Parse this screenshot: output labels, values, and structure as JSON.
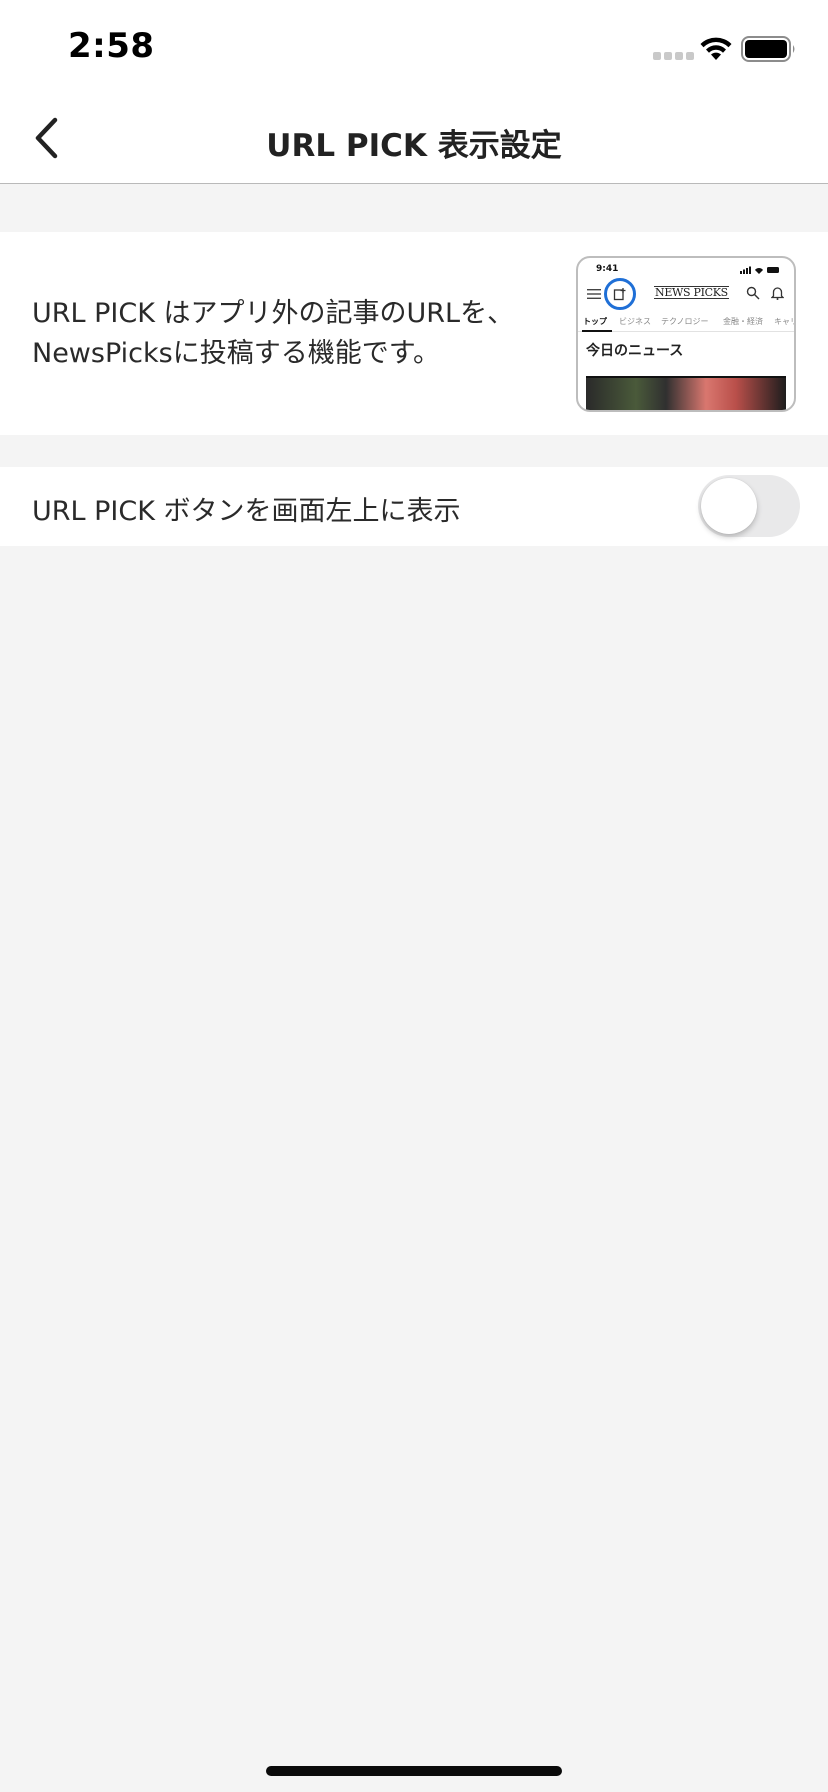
{
  "status_bar": {
    "time": "2:58"
  },
  "nav": {
    "title": "URL PICK 表示設定",
    "back_icon": "chevron-left-icon"
  },
  "description": {
    "text": "URL PICK はアプリ外の記事のURLを、NewsPicksに投稿する機能です。",
    "preview": {
      "status_time": "9:41",
      "logo": "NEWS PICKS",
      "tabs": [
        "トップ",
        "ビジネス",
        "テクノロジー",
        "金融・経済",
        "キャリ"
      ],
      "active_tab": "トップ",
      "heading": "今日のニュース",
      "highlight_color": "#1f6fd6"
    }
  },
  "settings": {
    "show_url_pick_button": {
      "label": "URL PICK ボタンを画面左上に表示",
      "enabled": false
    }
  },
  "colors": {
    "background": "#f4f4f4",
    "switch_off": "#e9e9ea"
  }
}
